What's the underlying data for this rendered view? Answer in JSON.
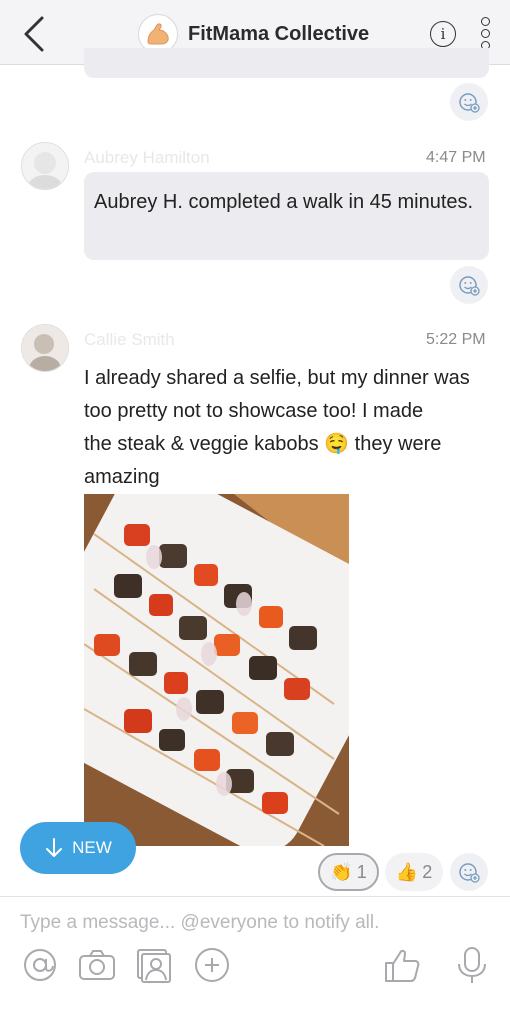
{
  "header": {
    "title": "FitMama Collective",
    "info_label": "i"
  },
  "messages": [
    {
      "sender": "Aubrey Hamilton",
      "time": "4:47 PM",
      "text": "Aubrey H. completed a walk in 45 minutes."
    },
    {
      "sender": "Callie Smith",
      "time": "5:22 PM",
      "text_lines": [
        "I already shared a selfie, but my dinner was",
        "too pretty not to showcase too! I made",
        "the steak & veggie kabobs",
        "they were",
        "amazing"
      ],
      "emoji": "🤤",
      "reactions": [
        {
          "icon": "clap-icon",
          "count": "1"
        },
        {
          "icon": "thumbs-up-icon",
          "count": "2"
        }
      ]
    }
  ],
  "new_button": {
    "label": "NEW"
  },
  "composer": {
    "placeholder": "Type a message... @everyone to notify all."
  },
  "colors": {
    "accent": "#3fa3e2",
    "bubble": "#ececf0",
    "header_bg": "#f4f4f6"
  }
}
